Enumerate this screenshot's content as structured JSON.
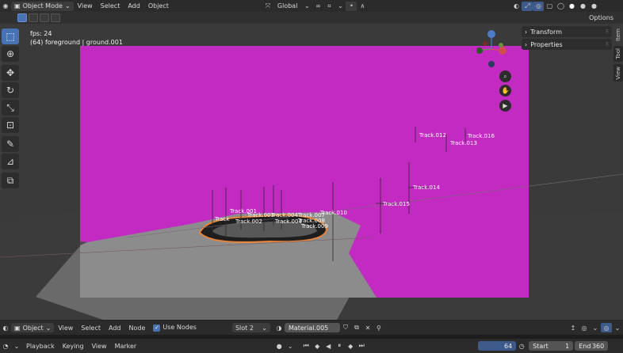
{
  "header": {
    "mode": "Object Mode",
    "menus": [
      "View",
      "Select",
      "Add",
      "Object"
    ],
    "orientation": "Global",
    "options": "Options"
  },
  "toolbar_tools": [
    "select-box-icon",
    "cursor-icon",
    "move-icon",
    "rotate-icon",
    "scale-icon",
    "transform-icon",
    "annotate-icon",
    "measure-icon",
    "add-cube-icon"
  ],
  "viewport": {
    "fps": "fps: 24",
    "object_info": "(64) foreground | ground.001",
    "tracks": [
      {
        "label": "Track.012"
      },
      {
        "label": "Track.016"
      },
      {
        "label": "Track.013"
      },
      {
        "label": "Track.014"
      },
      {
        "label": "Track.015"
      },
      {
        "label": "Track.001"
      },
      {
        "label": "Track.003"
      },
      {
        "label": "Track.004"
      },
      {
        "label": "Track.007"
      },
      {
        "label": "Track.010"
      },
      {
        "label": "Track.002"
      },
      {
        "label": "Track.008"
      },
      {
        "label": "Track.009"
      },
      {
        "label": "Track"
      },
      {
        "label": "Track.004"
      }
    ],
    "accent_color": "#c22ac2"
  },
  "sidebar": {
    "panels": [
      "Transform",
      "Properties"
    ],
    "tabs": [
      "Item",
      "Tool",
      "View"
    ]
  },
  "node_header": {
    "type": "Object",
    "menus": [
      "View",
      "Select",
      "Add",
      "Node"
    ],
    "use_nodes": "Use Nodes",
    "slot": "Slot 2",
    "material": "Material.005"
  },
  "timeline": {
    "menus": [
      "Playback",
      "Keying",
      "View",
      "Marker"
    ],
    "current_frame": "64",
    "start_label": "Start",
    "start_value": "1",
    "end_label": "End",
    "end_value": "360"
  }
}
